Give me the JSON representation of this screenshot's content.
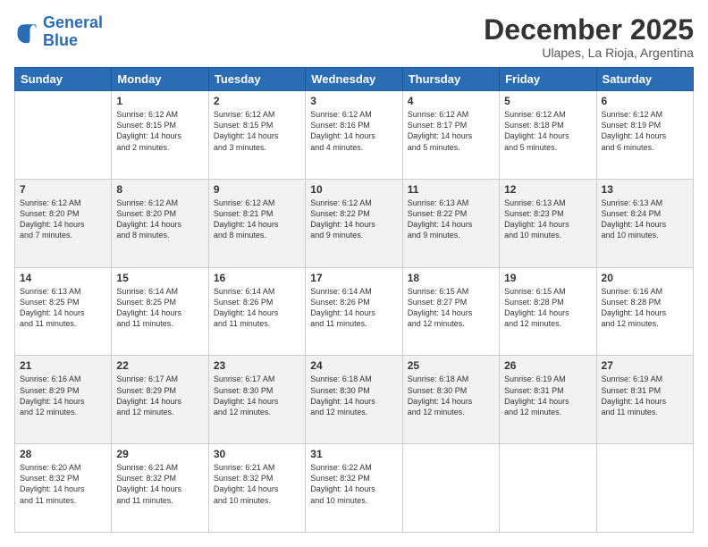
{
  "logo": {
    "line1": "General",
    "line2": "Blue"
  },
  "header": {
    "title": "December 2025",
    "subtitle": "Ulapes, La Rioja, Argentina"
  },
  "weekdays": [
    "Sunday",
    "Monday",
    "Tuesday",
    "Wednesday",
    "Thursday",
    "Friday",
    "Saturday"
  ],
  "weeks": [
    [
      {
        "day": "",
        "info": ""
      },
      {
        "day": "1",
        "info": "Sunrise: 6:12 AM\nSunset: 8:15 PM\nDaylight: 14 hours\nand 2 minutes."
      },
      {
        "day": "2",
        "info": "Sunrise: 6:12 AM\nSunset: 8:15 PM\nDaylight: 14 hours\nand 3 minutes."
      },
      {
        "day": "3",
        "info": "Sunrise: 6:12 AM\nSunset: 8:16 PM\nDaylight: 14 hours\nand 4 minutes."
      },
      {
        "day": "4",
        "info": "Sunrise: 6:12 AM\nSunset: 8:17 PM\nDaylight: 14 hours\nand 5 minutes."
      },
      {
        "day": "5",
        "info": "Sunrise: 6:12 AM\nSunset: 8:18 PM\nDaylight: 14 hours\nand 5 minutes."
      },
      {
        "day": "6",
        "info": "Sunrise: 6:12 AM\nSunset: 8:19 PM\nDaylight: 14 hours\nand 6 minutes."
      }
    ],
    [
      {
        "day": "7",
        "info": "Sunrise: 6:12 AM\nSunset: 8:20 PM\nDaylight: 14 hours\nand 7 minutes."
      },
      {
        "day": "8",
        "info": "Sunrise: 6:12 AM\nSunset: 8:20 PM\nDaylight: 14 hours\nand 8 minutes."
      },
      {
        "day": "9",
        "info": "Sunrise: 6:12 AM\nSunset: 8:21 PM\nDaylight: 14 hours\nand 8 minutes."
      },
      {
        "day": "10",
        "info": "Sunrise: 6:12 AM\nSunset: 8:22 PM\nDaylight: 14 hours\nand 9 minutes."
      },
      {
        "day": "11",
        "info": "Sunrise: 6:13 AM\nSunset: 8:22 PM\nDaylight: 14 hours\nand 9 minutes."
      },
      {
        "day": "12",
        "info": "Sunrise: 6:13 AM\nSunset: 8:23 PM\nDaylight: 14 hours\nand 10 minutes."
      },
      {
        "day": "13",
        "info": "Sunrise: 6:13 AM\nSunset: 8:24 PM\nDaylight: 14 hours\nand 10 minutes."
      }
    ],
    [
      {
        "day": "14",
        "info": "Sunrise: 6:13 AM\nSunset: 8:25 PM\nDaylight: 14 hours\nand 11 minutes."
      },
      {
        "day": "15",
        "info": "Sunrise: 6:14 AM\nSunset: 8:25 PM\nDaylight: 14 hours\nand 11 minutes."
      },
      {
        "day": "16",
        "info": "Sunrise: 6:14 AM\nSunset: 8:26 PM\nDaylight: 14 hours\nand 11 minutes."
      },
      {
        "day": "17",
        "info": "Sunrise: 6:14 AM\nSunset: 8:26 PM\nDaylight: 14 hours\nand 11 minutes."
      },
      {
        "day": "18",
        "info": "Sunrise: 6:15 AM\nSunset: 8:27 PM\nDaylight: 14 hours\nand 12 minutes."
      },
      {
        "day": "19",
        "info": "Sunrise: 6:15 AM\nSunset: 8:28 PM\nDaylight: 14 hours\nand 12 minutes."
      },
      {
        "day": "20",
        "info": "Sunrise: 6:16 AM\nSunset: 8:28 PM\nDaylight: 14 hours\nand 12 minutes."
      }
    ],
    [
      {
        "day": "21",
        "info": "Sunrise: 6:16 AM\nSunset: 8:29 PM\nDaylight: 14 hours\nand 12 minutes."
      },
      {
        "day": "22",
        "info": "Sunrise: 6:17 AM\nSunset: 8:29 PM\nDaylight: 14 hours\nand 12 minutes."
      },
      {
        "day": "23",
        "info": "Sunrise: 6:17 AM\nSunset: 8:30 PM\nDaylight: 14 hours\nand 12 minutes."
      },
      {
        "day": "24",
        "info": "Sunrise: 6:18 AM\nSunset: 8:30 PM\nDaylight: 14 hours\nand 12 minutes."
      },
      {
        "day": "25",
        "info": "Sunrise: 6:18 AM\nSunset: 8:30 PM\nDaylight: 14 hours\nand 12 minutes."
      },
      {
        "day": "26",
        "info": "Sunrise: 6:19 AM\nSunset: 8:31 PM\nDaylight: 14 hours\nand 12 minutes."
      },
      {
        "day": "27",
        "info": "Sunrise: 6:19 AM\nSunset: 8:31 PM\nDaylight: 14 hours\nand 11 minutes."
      }
    ],
    [
      {
        "day": "28",
        "info": "Sunrise: 6:20 AM\nSunset: 8:32 PM\nDaylight: 14 hours\nand 11 minutes."
      },
      {
        "day": "29",
        "info": "Sunrise: 6:21 AM\nSunset: 8:32 PM\nDaylight: 14 hours\nand 11 minutes."
      },
      {
        "day": "30",
        "info": "Sunrise: 6:21 AM\nSunset: 8:32 PM\nDaylight: 14 hours\nand 10 minutes."
      },
      {
        "day": "31",
        "info": "Sunrise: 6:22 AM\nSunset: 8:32 PM\nDaylight: 14 hours\nand 10 minutes."
      },
      {
        "day": "",
        "info": ""
      },
      {
        "day": "",
        "info": ""
      },
      {
        "day": "",
        "info": ""
      }
    ]
  ]
}
